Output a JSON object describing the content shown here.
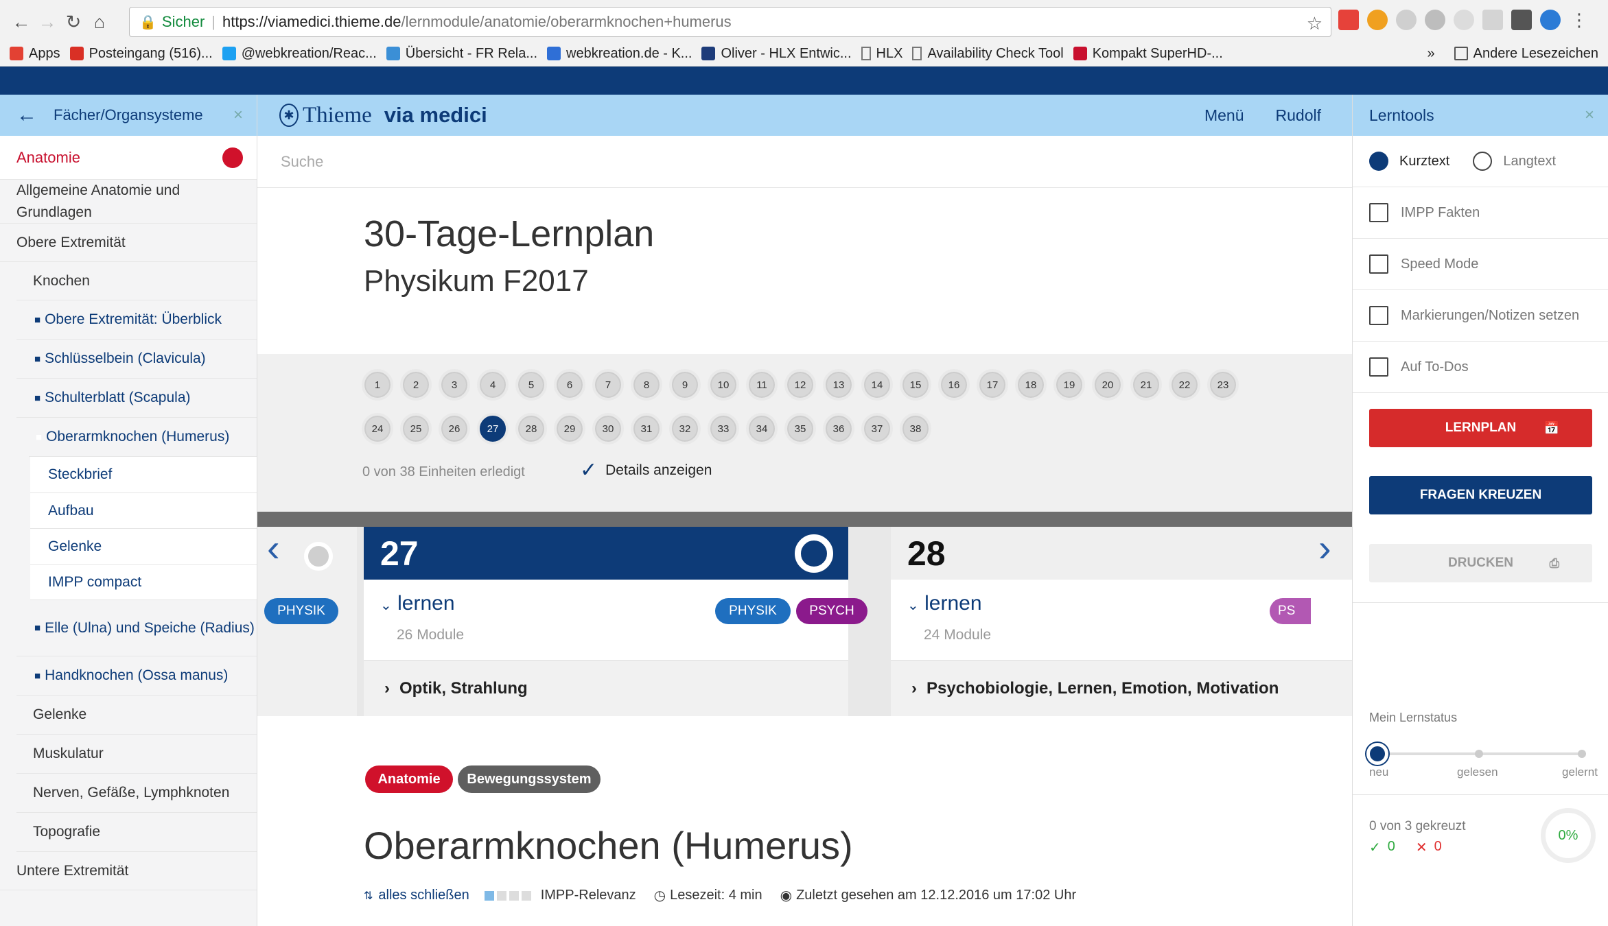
{
  "browser": {
    "secure_label": "Sicher",
    "url_host": "https://viamedici.thieme.de",
    "url_path": "/lernmodule/anatomie/oberarmknochen+humerus",
    "bookmarks": [
      {
        "label": "Apps",
        "icon": "apps-grid-icon",
        "color": "#e34133"
      },
      {
        "label": "Posteingang (516)...",
        "icon": "gmail-icon",
        "color": "#d93025"
      },
      {
        "label": "@webkreation/Reac...",
        "icon": "twitter-icon",
        "color": "#1da1f2"
      },
      {
        "label": "Übersicht - FR Rela...",
        "icon": "gear-icon",
        "color": "#3b8fd6"
      },
      {
        "label": "webkreation.de - K...",
        "icon": "calendar-icon",
        "color": "#2f6fd6"
      },
      {
        "label": "Oliver - HLX Entwic...",
        "icon": "hlx-icon",
        "color": "#1e3c7a"
      },
      {
        "label": "HLX",
        "icon": "page-icon",
        "color": "#777777"
      },
      {
        "label": "Availability Check Tool",
        "icon": "page-icon",
        "color": "#777777"
      },
      {
        "label": "Kompakt SuperHD-...",
        "icon": "k-icon",
        "color": "#c8102e"
      }
    ],
    "overflow": "»",
    "other_bookmarks": "Andere Lesezeichen"
  },
  "sidebar": {
    "header": "Fächer/Organsysteme",
    "subject": "Anatomie",
    "items": [
      {
        "label": "Allgemeine Anatomie und Grundlagen",
        "level": 0
      },
      {
        "label": "Obere Extremität",
        "level": 0
      },
      {
        "label": "Knochen",
        "level": 1
      },
      {
        "label": "Obere Extremität: Überblick",
        "level": 2,
        "doc": true
      },
      {
        "label": "Schlüsselbein (Clavicula)",
        "level": 2,
        "doc": true
      },
      {
        "label": "Schulterblatt (Scapula)",
        "level": 2,
        "doc": true
      },
      {
        "label": "Oberarmknochen (Humerus)",
        "level": 2,
        "doc": true,
        "active": true
      },
      {
        "label": "Steckbrief",
        "level": 3
      },
      {
        "label": "Aufbau",
        "level": 3
      },
      {
        "label": "Gelenke",
        "level": 3
      },
      {
        "label": "IMPP compact",
        "level": 3
      },
      {
        "label": "Elle (Ulna) und Speiche (Radius)",
        "level": 2,
        "doc": true
      },
      {
        "label": "Handknochen (Ossa manus)",
        "level": 2,
        "doc": true
      },
      {
        "label": "Gelenke",
        "level": 1
      },
      {
        "label": "Muskulatur",
        "level": 1
      },
      {
        "label": "Nerven, Gefäße, Lymphknoten",
        "level": 1
      },
      {
        "label": "Topografie",
        "level": 1
      },
      {
        "label": "Untere Extremität",
        "level": 0
      }
    ]
  },
  "header": {
    "logo_text": "Thieme",
    "logo_sub": "via medici",
    "menu": "Menü",
    "user": "Rudolf"
  },
  "main": {
    "search_placeholder": "Suche",
    "title": "30-Tage-Lernplan",
    "subtitle": "Physikum F2017",
    "days": [
      "1",
      "2",
      "3",
      "4",
      "5",
      "6",
      "7",
      "8",
      "9",
      "10",
      "11",
      "12",
      "13",
      "14",
      "15",
      "16",
      "17",
      "18",
      "19",
      "20",
      "21",
      "22",
      "23",
      "24",
      "25",
      "26",
      "27",
      "28",
      "29",
      "30",
      "31",
      "32",
      "33",
      "34",
      "35",
      "36",
      "37",
      "38"
    ],
    "current_day": "27",
    "progress_text": "0 von 38 Einheiten erledigt",
    "details_label": "Details anzeigen",
    "prev_tag": "PHYSIK",
    "next_tag": "PS",
    "cards": [
      {
        "day": "27",
        "lernen": "lernen",
        "modules": "26 Module",
        "tags": [
          "PHYSIK",
          "PSYCH"
        ],
        "topic": "Optik, Strahlung"
      },
      {
        "day": "28",
        "lernen": "lernen",
        "modules": "24 Module",
        "tags": [],
        "topic": "Psychobiologie, Lernen, Emotion, Motivation"
      }
    ],
    "tags": [
      "Anatomie",
      "Bewegungssystem"
    ],
    "article_title": "Oberarmknochen (Humerus)",
    "collapse_all": "alles schließen",
    "impp_relevanz": "IMPP-Relevanz",
    "impp_level": 1,
    "reading_time": "Lesezeit: 4 min",
    "last_seen": "Zuletzt gesehen am 12.12.2016 um 17:02 Uhr"
  },
  "tools": {
    "header": "Lerntools",
    "kurztext": "Kurztext",
    "langtext": "Langtext",
    "options": [
      "IMPP Fakten",
      "Speed Mode",
      "Markierungen/Notizen setzen",
      "Auf To-Dos"
    ],
    "btn_lernplan": "LERNPLAN",
    "btn_fragen": "FRAGEN KREUZEN",
    "btn_drucken": "DRUCKEN",
    "lernstatus": "Mein Lernstatus",
    "status_labels": [
      "neu",
      "gelesen",
      "gelernt"
    ],
    "kreuz_text": "0 von 3 gekreuzt",
    "correct": "0",
    "wrong": "0",
    "percent": "0%"
  },
  "colors": {
    "navy": "#0d3b78",
    "light_blue": "#a9d6f5",
    "red": "#d0112b",
    "purple": "#8b1a8c",
    "physik_blue": "#1f6fbf",
    "grey_tag": "#5f5f5f"
  }
}
